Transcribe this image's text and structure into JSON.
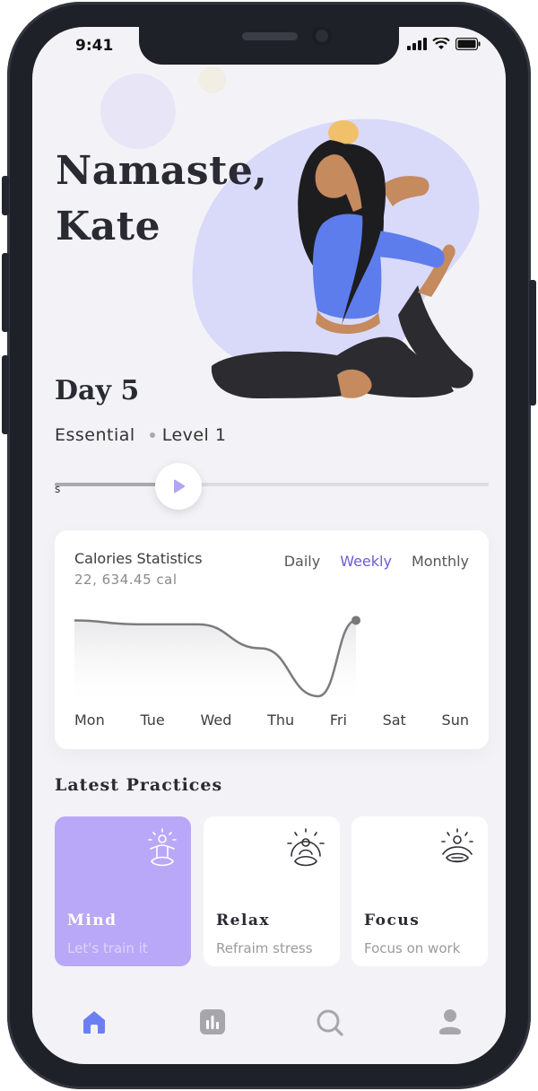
{
  "status_bar": {
    "time": "9:41"
  },
  "greeting": {
    "line1": "Namaste,",
    "line2": "Kate"
  },
  "session": {
    "day": "Day 5",
    "program": "Essential",
    "level": "Level 1",
    "progress_label": "s",
    "progress": 0.26
  },
  "calories": {
    "title": "Calories Statistics",
    "total": "22, 634.45  cal",
    "tabs": [
      {
        "label": "Daily",
        "active": false
      },
      {
        "label": "Weekly",
        "active": true
      },
      {
        "label": "Monthly",
        "active": false
      }
    ],
    "accent": "#6b5bd9"
  },
  "chart_data": {
    "type": "area",
    "categories": [
      "Mon",
      "Tue",
      "Wed",
      "Thu",
      "Fri",
      "Sat",
      "Sun"
    ],
    "series": [
      {
        "values": [
          0.95,
          0.9,
          0.9,
          0.6,
          0.0,
          0.95
        ]
      }
    ],
    "grid": false
  },
  "practices": {
    "title": "Latest Practices",
    "items": [
      {
        "title": "Mind",
        "subtitle": "Let's train it",
        "icon": "meditation-icon",
        "active": true
      },
      {
        "title": "Relax",
        "subtitle": "Refraim stress",
        "icon": "relax-meditation-icon",
        "active": false
      },
      {
        "title": "Focus",
        "subtitle": "Focus on work",
        "icon": "focus-meditation-icon",
        "active": false
      }
    ]
  },
  "tab_bar": [
    {
      "icon": "home-icon",
      "active": true
    },
    {
      "icon": "stats-icon",
      "active": false
    },
    {
      "icon": "search-icon",
      "active": false
    },
    {
      "icon": "profile-icon",
      "active": false
    }
  ],
  "colors": {
    "accent": "#6b5bd9",
    "mind_card": "#b9a8f7",
    "blob": "#d9dafa",
    "background": "#f3f3f7"
  }
}
